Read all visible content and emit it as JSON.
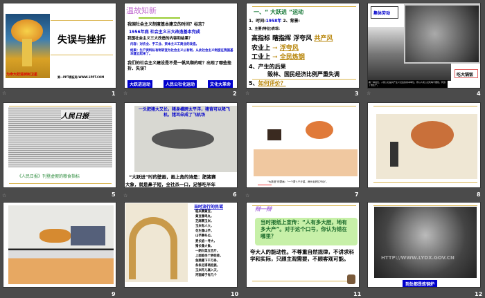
{
  "slides": [
    {
      "number": "1",
      "title": "失误与挫折",
      "poster_caption": "为命大跃进树树卫星",
      "footer": "第一PPT模板网-WWW.1PPT.COM"
    },
    {
      "number": "2",
      "heading": "温故知新",
      "q1": "我国社会主义制度基本建立的时间？标志？",
      "a1": "1956年底  社会主义三大改造基本完成",
      "q2": "我国社会主义三大改造的内容和结果？",
      "a2": "内容：对农业、手工业、资本主义工商业的改造。",
      "a3": "结果：生产资料私有制转变为社会主义公有制，从此社会主义制度在我国基本建立起来了。",
      "q3": "我们的社会主义建设是不是一帆风顺的呢？出现了哪些挫折、失误？",
      "buttons": [
        "大跃进运动",
        "人民公社化运动",
        "文化大革命"
      ]
    },
    {
      "number": "3",
      "heading": "一、“ 大跃进 ”运动",
      "l1a": "1、时间:",
      "l1b": "1958年",
      "l1c": " 2、背景:",
      "l2": "3、主要(特征)表现:",
      "l3": "高指标  瞎指挥  浮夸风",
      "l3b": "共产风",
      "l4": "农业上",
      "l4b": "浮夸风",
      "l5": "工业上",
      "l5b": "全民炼钢",
      "l6": "4、产生的后果",
      "l7": "毁林、国民经济比例严重失调",
      "l8": "5、",
      "l8b": "如何评价？"
    },
    {
      "number": "4",
      "bubble": "集体劳动",
      "label": "吃大锅饭",
      "caption": "看一种说法，人民公社是共产主义社会的基本单位，所以人民公社吃喝不要钱，刺激了他生产。"
    },
    {
      "number": "5",
      "caption": "《人民日报》刊登虚假的粮食指标",
      "paper_name": "人民日报"
    },
    {
      "number": "6",
      "top": "一头肥猪大又长，猪身横跨太平洋，猪背可以降飞机，猪耳朵成了飞机场",
      "bottom1": "“大跃进”时的壁画，画上角的诗是：肥猪赛",
      "bottom2": "大象，就是鼻子短，全社杀一口，足够吃半年"
    },
    {
      "number": "7",
      "caption": "“大跃进”时壁画：“一个萝卜千斤重，两头毛驴拉不动”。"
    },
    {
      "number": "8"
    },
    {
      "number": "9"
    },
    {
      "number": "10",
      "poem_title": "当时流行的民谣",
      "poem": [
        "稻米赛黄豆，",
        "黄豆像鸡丸，",
        "芝麻赛玉米，",
        "玉米有人大，",
        "花生像山芋，",
        "山芋赛冬瓜，",
        "麦长掂一寻大，",
        "猪长像大象，",
        "一朗白菜五百斤，",
        "上面能坐个胖娃娃，",
        "鱼跳撒下千万条，",
        "条条足得两担挑，",
        "玉米秆儿高入天，",
        "河面嫁子有几个"
      ]
    },
    {
      "number": "11",
      "tag": "辩一辩",
      "question": "当时报纸上宣传：“人有多大胆，地有多大产”。对于这个口号，你认为错在哪里？",
      "answer": "夸大人的能动性。不尊重自然规律，不讲求科学和实际，只顾主观需要，不顾客观可能。"
    },
    {
      "number": "12",
      "watermark": "HTTP://WWW.LYDX.GOV.CN",
      "caption": "到处都是炼钢炉"
    }
  ]
}
